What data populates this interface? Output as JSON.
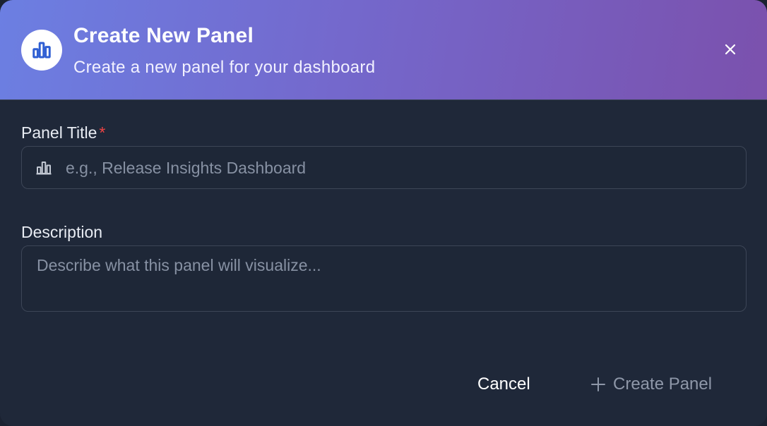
{
  "dialog": {
    "title": "Create New Panel",
    "subtitle": "Create a new panel for your dashboard",
    "header_icon": "bar-chart-icon",
    "close_icon": "close-icon"
  },
  "form": {
    "title_field": {
      "label": "Panel Title",
      "required_marker": "*",
      "placeholder": "e.g., Release Insights Dashboard",
      "value": "",
      "icon": "bar-chart-icon"
    },
    "description_field": {
      "label": "Description",
      "placeholder": "Describe what this panel will visualize...",
      "value": ""
    }
  },
  "actions": {
    "cancel_label": "Cancel",
    "create_label": "Create Panel",
    "create_icon": "plus-icon"
  },
  "colors": {
    "header_gradient_start": "#6c7fe2",
    "header_gradient_end": "#7b51ad",
    "background": "#1f2839",
    "required": "#ef4444",
    "accent_icon": "#2f5fd3"
  }
}
